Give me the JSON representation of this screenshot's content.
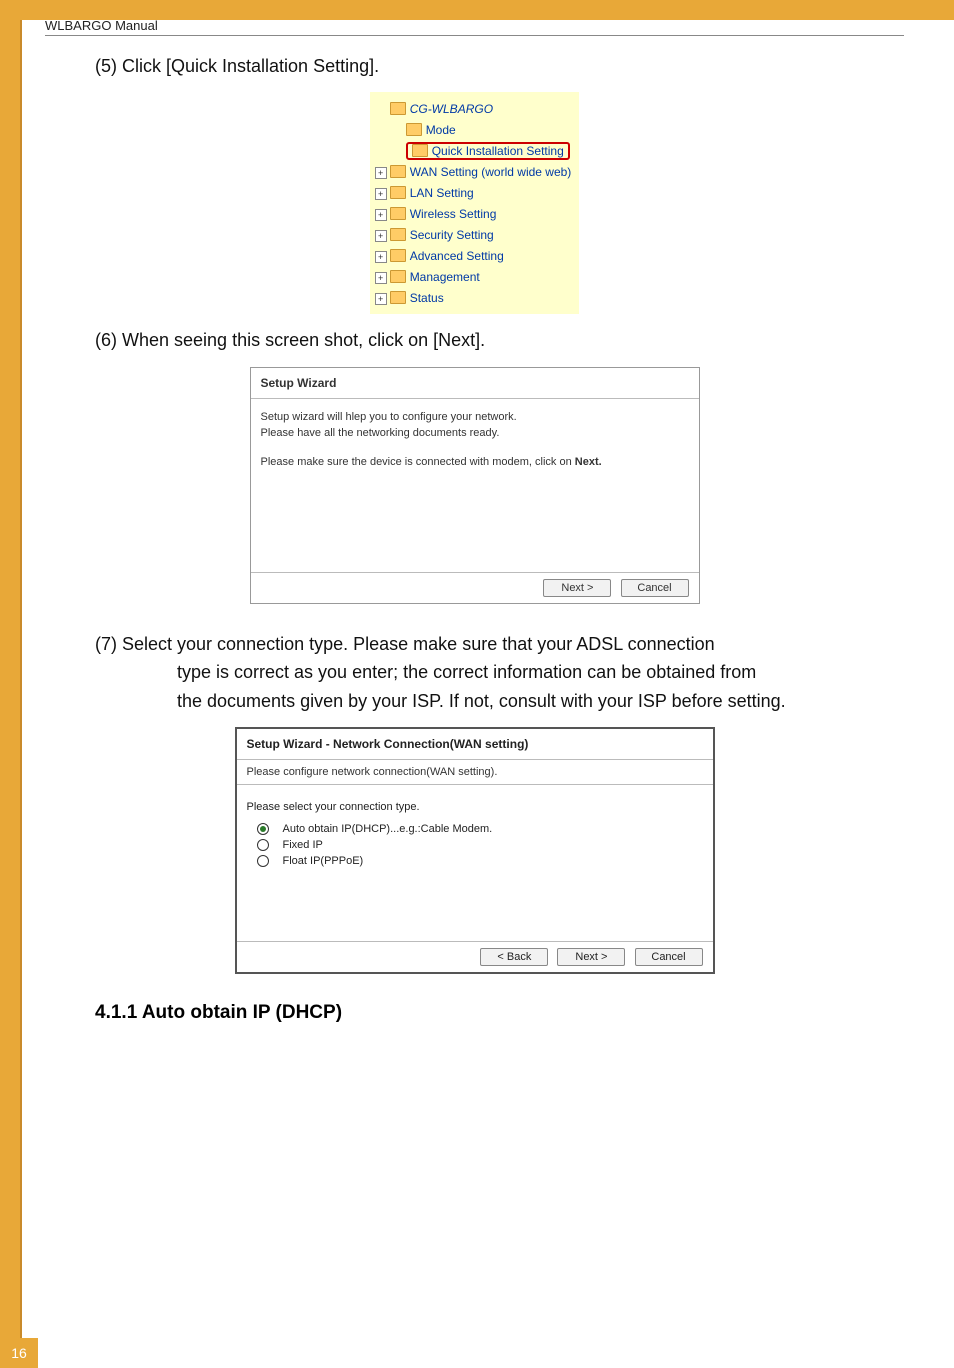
{
  "header": {
    "title": "WLBARGO Manual"
  },
  "step5": {
    "text": "(5) Click [Quick Installation Setting]."
  },
  "tree": {
    "root": "CG-WLBARGO",
    "items": [
      "Mode",
      "Quick Installation Setting",
      "WAN Setting (world wide web)",
      "LAN Setting",
      "Wireless Setting",
      "Security Setting",
      "Advanced Setting",
      "Management",
      "Status"
    ]
  },
  "step6": {
    "text": "(6) When seeing this screen shot, click on [Next]."
  },
  "wizard1": {
    "title": "Setup Wizard",
    "line1": "Setup wizard will hlep you to configure your network.",
    "line2": "Please have all the networking documents ready.",
    "line3_a": "Please make sure the device is connected with modem, click on ",
    "line3_b": "Next.",
    "next": "Next >",
    "cancel": "Cancel"
  },
  "step7": {
    "l1": "(7) Select your connection type. Please make sure that your ADSL connection",
    "l2": "type is correct as you enter; the correct information can be obtained from",
    "l3": "the documents given by your ISP. If not, consult with your ISP before setting."
  },
  "wizard2": {
    "title": "Setup Wizard - Network Connection(WAN setting)",
    "sub": "Please configure network connection(WAN setting).",
    "prompt": "Please select your connection type.",
    "options": [
      "Auto obtain IP(DHCP)...e.g.:Cable Modem.",
      "Fixed IP",
      "Float IP(PPPoE)"
    ],
    "back": "< Back",
    "next": "Next >",
    "cancel": "Cancel"
  },
  "subheading": {
    "text": "4.1.1 Auto obtain IP (DHCP)"
  },
  "pageNumber": "16"
}
